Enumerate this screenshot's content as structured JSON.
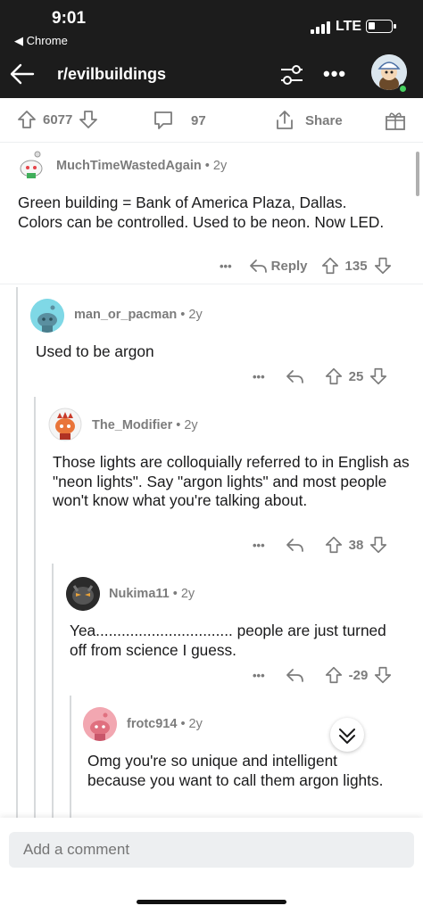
{
  "status_bar": {
    "time": "9:01",
    "back_app": "◀ Chrome",
    "network": "LTE"
  },
  "header": {
    "title": "r/evilbuildings",
    "more": "•••"
  },
  "post_bar": {
    "upvotes": "6077",
    "comments": "97",
    "share": "Share"
  },
  "comments": [
    {
      "author": "MuchTimeWastedAgain",
      "age": " • 2y",
      "body": "Green building = Bank of America Plaza, Dallas. Colors can be controlled. Used to be neon. Now LED.",
      "reply": "Reply",
      "score": "135",
      "more": "•••"
    },
    {
      "author": "man_or_pacman",
      "age": " • 2y",
      "body": "Used to be argon",
      "score": "25",
      "more": "•••"
    },
    {
      "author": "The_Modifier",
      "age": " • 2y",
      "body": "Those lights are colloquially referred to in English as \"neon lights\". Say \"argon lights\" and most people won't know what you're talking about.",
      "score": "38",
      "more": "•••"
    },
    {
      "author": "Nukima11",
      "age": " • 2y",
      "body": "Yea................................ people are just turned off from science I guess.",
      "score": "-29",
      "more": "•••"
    },
    {
      "author": "frotc914",
      "age": " • 2y",
      "body": "Omg you're so unique and intelligent because you want to call them argon lights."
    }
  ],
  "composer": {
    "placeholder": "Add a comment"
  },
  "colors": {
    "upvote": "#7c7c7c",
    "online": "#46d160",
    "dark_header": "#1c1c1c"
  }
}
